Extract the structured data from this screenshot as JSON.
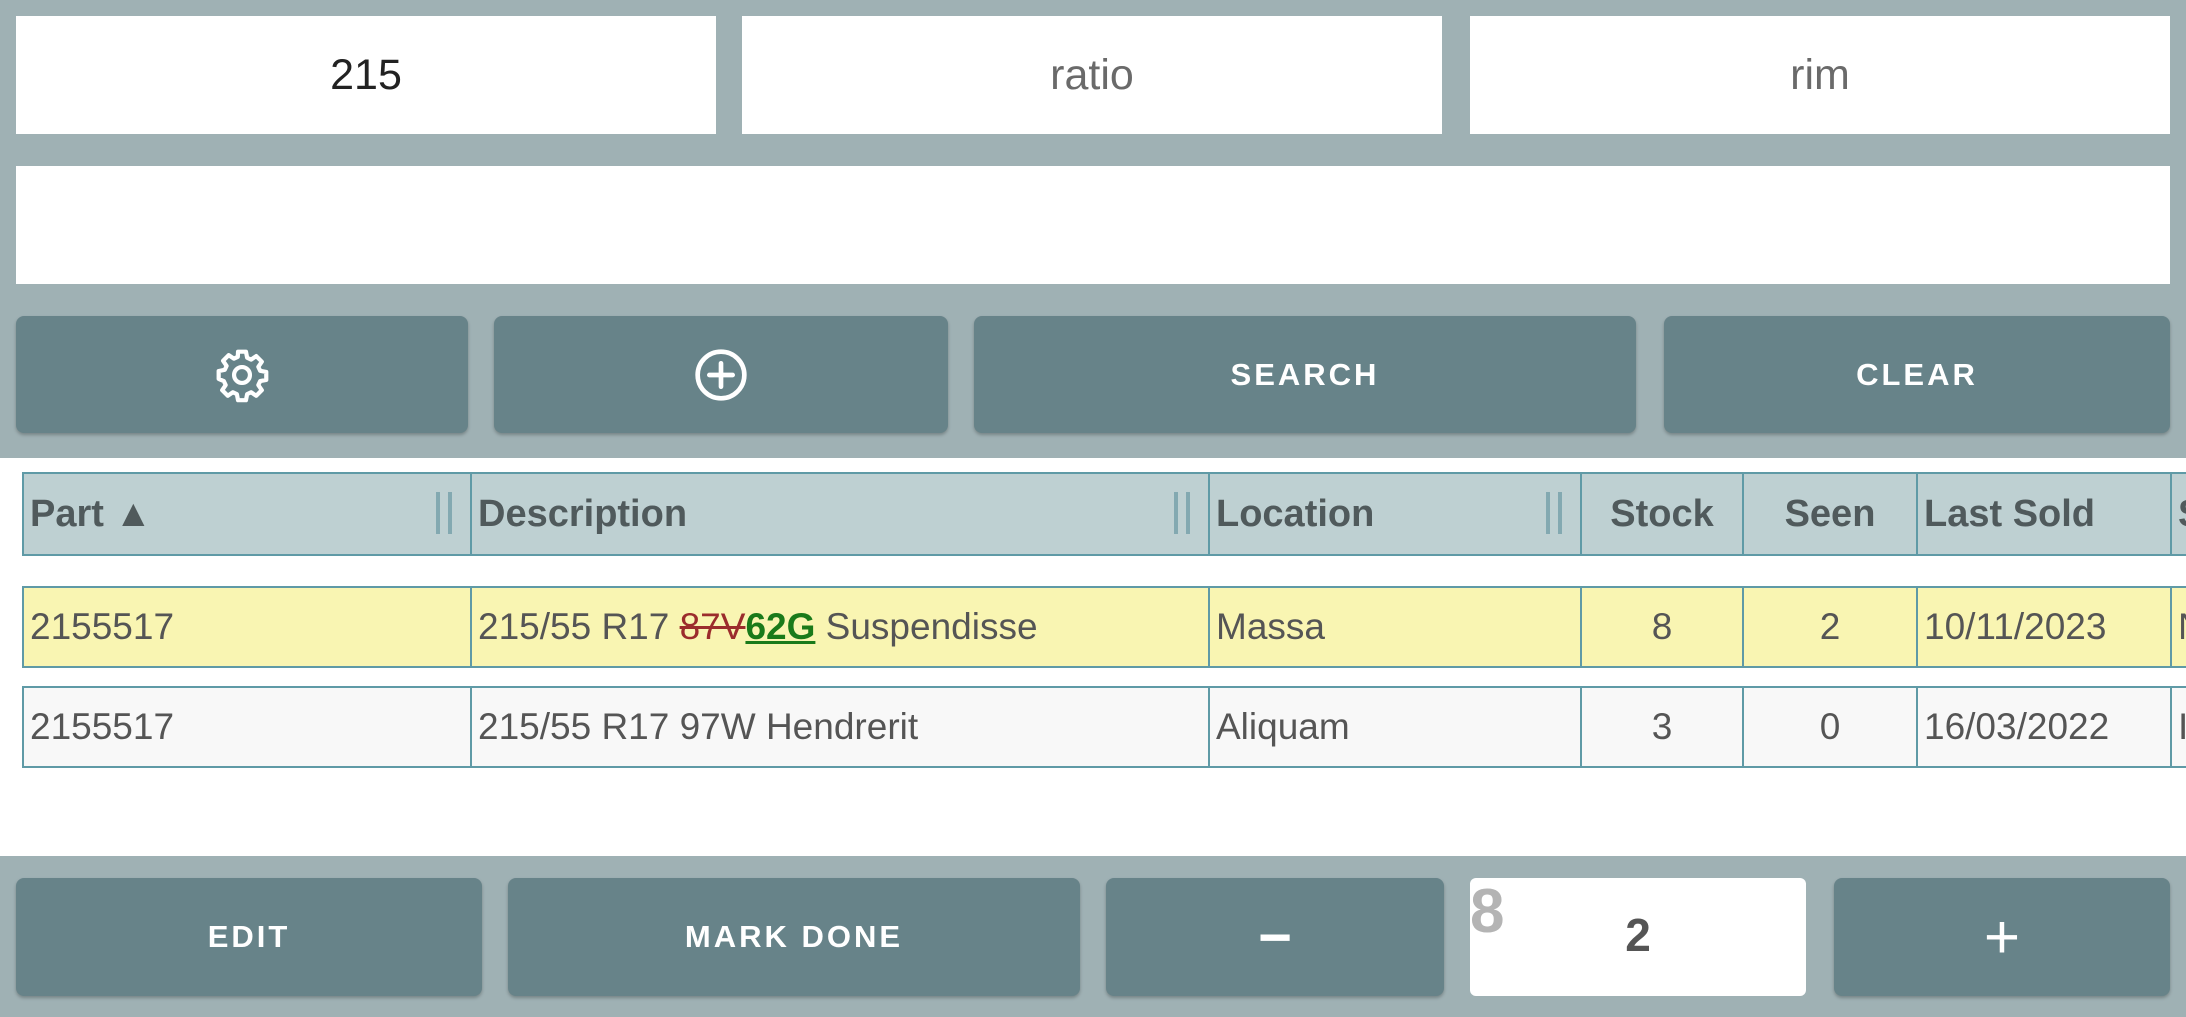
{
  "search": {
    "width_value": "215",
    "ratio_placeholder": "ratio",
    "rim_placeholder": "rim",
    "text_value": ""
  },
  "toolbar": {
    "settings_icon": "gear-icon",
    "add_icon": "plus-circle-icon",
    "search_label": "SEARCH",
    "clear_label": "CLEAR"
  },
  "table": {
    "columns": [
      "Part ▲",
      "Description",
      "Location",
      "Stock",
      "Seen",
      "Last Sold",
      "S"
    ],
    "rows": [
      {
        "part": "2155517",
        "desc_prefix": "215/55 R17 ",
        "desc_old": "87V",
        "desc_new": "62G",
        "desc_suffix": " Suspendisse",
        "location": "Massa",
        "stock": "8",
        "seen": "2",
        "last_sold": "10/11/2023",
        "extra": "N",
        "highlighted": true
      },
      {
        "part": "2155517",
        "description": "215/55 R17 97W Hendrerit",
        "location": "Aliquam",
        "stock": "3",
        "seen": "0",
        "last_sold": "16/03/2022",
        "extra": "I",
        "highlighted": false
      }
    ]
  },
  "actions": {
    "edit_label": "EDIT",
    "mark_done_label": "MARK DONE",
    "minus_label": "−",
    "plus_label": "+",
    "stock_hint": "8",
    "quantity": "2"
  },
  "colors": {
    "bar": "#9fb1b4",
    "button": "#678389",
    "header": "#bed0d2",
    "highlight_row": "#f9f5b2",
    "grid_border": "#5f9aa6",
    "struck_code": "#9b2c2c",
    "new_code": "#1a7a1a"
  }
}
